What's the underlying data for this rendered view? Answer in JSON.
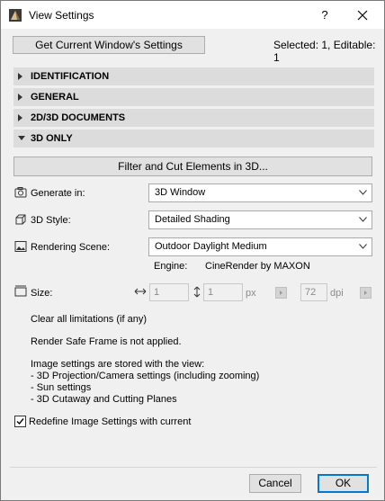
{
  "window": {
    "title": "View Settings",
    "help": "?"
  },
  "header": {
    "get_settings_button": "Get Current Window's Settings",
    "selection_info": "Selected: 1, Editable: 1"
  },
  "sections": [
    {
      "label": "IDENTIFICATION",
      "expanded": false
    },
    {
      "label": "GENERAL",
      "expanded": false
    },
    {
      "label": "2D/3D DOCUMENTS",
      "expanded": false
    },
    {
      "label": "3D ONLY",
      "expanded": true
    }
  ],
  "three_d": {
    "filter_button": "Filter and Cut Elements in 3D...",
    "generate_in": {
      "label": "Generate in:",
      "value": "3D Window"
    },
    "style": {
      "label": "3D Style:",
      "value": "Detailed Shading"
    },
    "rendering_scene": {
      "label": "Rendering Scene:",
      "value": "Outdoor Daylight Medium"
    },
    "engine": {
      "label": "Engine:",
      "value": "CineRender by MAXON"
    },
    "size": {
      "label": "Size:",
      "width_value": "1",
      "height_value": "1",
      "unit": "px",
      "dpi_value": "72",
      "dpi_unit": "dpi"
    },
    "info_lines": {
      "clear_limitations": "Clear all limitations (if any)",
      "safe_frame": "Render Safe Frame is not applied.",
      "stored_intro": "Image settings are stored with the view:",
      "stored_item_1": "- 3D Projection/Camera settings (including zooming)",
      "stored_item_2": "- Sun settings",
      "stored_item_3": "- 3D Cutaway and Cutting Planes"
    },
    "redefine": {
      "label": "Redefine Image Settings with current",
      "checked": true
    }
  },
  "footer": {
    "cancel_label": "Cancel",
    "ok_label": "OK"
  },
  "colors": {
    "ok_border": "#0078d7",
    "section_bg": "#dcdcdc",
    "dialog_bg": "#f0f0f0"
  }
}
